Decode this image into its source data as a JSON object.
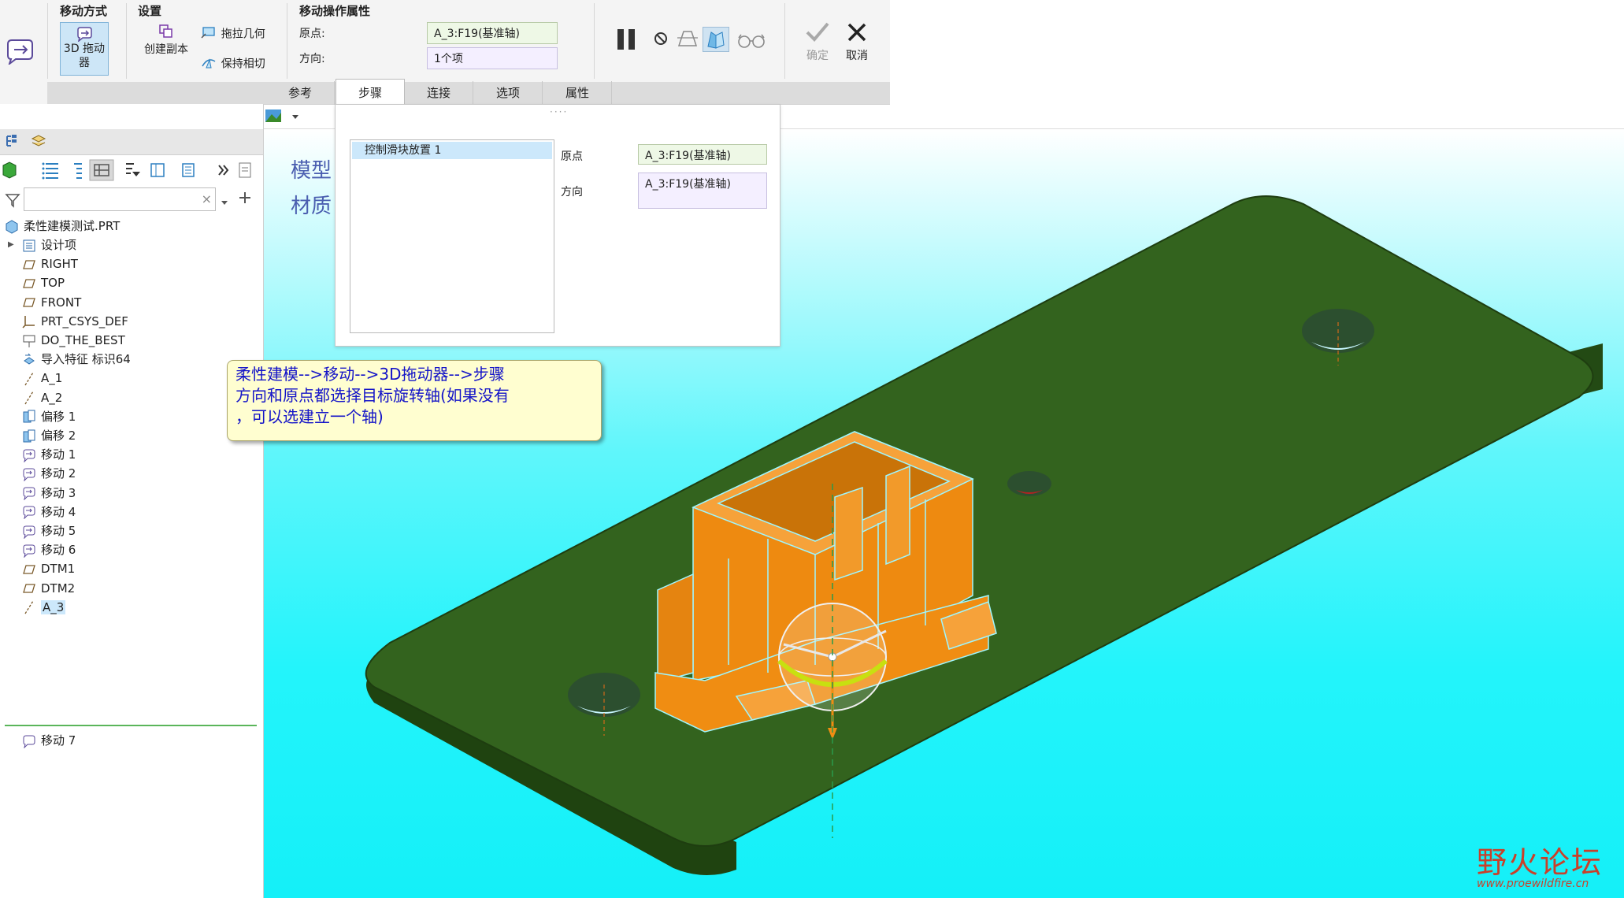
{
  "ribbon": {
    "move_type_title": "移动方式",
    "drag_3d_label_1": "3D 拖动",
    "drag_3d_label_2": "器",
    "settings_title": "设置",
    "create_copy_label": "创建副本",
    "drag_geometry_label": "拖拉几何",
    "keep_tangent_label": "保持相切",
    "move_props_title": "移动操作属性",
    "origin_label": "原点:",
    "origin_value": "A_3:F19(基准轴)",
    "direction_label": "方向:",
    "direction_value": "1个项",
    "ok_label": "确定",
    "cancel_label": "取消",
    "tabs": [
      "参考",
      "步骤",
      "连接",
      "选项",
      "属性"
    ]
  },
  "step_panel": {
    "list_item": "控制滑块放置 1",
    "origin_label": "原点",
    "origin_value": "A_3:F19(基准轴)",
    "direction_label": "方向",
    "direction_value": "A_3:F19(基准轴)"
  },
  "model_tree": {
    "search_placeholder": "",
    "root": "柔性建模测试.PRT",
    "items": [
      {
        "label": "设计项",
        "icon": "layers-icon"
      },
      {
        "label": "RIGHT",
        "icon": "datum-plane-icon"
      },
      {
        "label": "TOP",
        "icon": "datum-plane-icon"
      },
      {
        "label": "FRONT",
        "icon": "datum-plane-icon"
      },
      {
        "label": "PRT_CSYS_DEF",
        "icon": "csys-icon"
      },
      {
        "label": "DO_THE_BEST",
        "icon": "annotation-icon"
      },
      {
        "label": "导入特征 标识64",
        "icon": "import-feature-icon"
      },
      {
        "label": "A_1",
        "icon": "datum-axis-icon"
      },
      {
        "label": "A_2",
        "icon": "datum-axis-icon"
      },
      {
        "label": "偏移 1",
        "icon": "offset-icon"
      },
      {
        "label": "偏移 2",
        "icon": "offset-icon"
      },
      {
        "label": "移动 1",
        "icon": "move-icon"
      },
      {
        "label": "移动 2",
        "icon": "move-icon"
      },
      {
        "label": "移动 3",
        "icon": "move-icon"
      },
      {
        "label": "移动 4",
        "icon": "move-icon"
      },
      {
        "label": "移动 5",
        "icon": "move-icon"
      },
      {
        "label": "移动 6",
        "icon": "move-icon"
      },
      {
        "label": "DTM1",
        "icon": "datum-plane-icon"
      },
      {
        "label": "DTM2",
        "icon": "datum-plane-icon"
      },
      {
        "label": "A_3",
        "icon": "datum-axis-icon"
      }
    ],
    "insert_item": "移动 7"
  },
  "viewport": {
    "model_info_1": "模型",
    "model_info_2": "材质",
    "callout_line1": "柔性建模-->移动-->3D拖动器-->步骤",
    "callout_line2": "方向和原点都选择目标旋转轴(如果没有",
    "callout_line3": "，可以选建立一个轴)",
    "watermark_title": "野火论坛",
    "watermark_url": "www.proewildfire.cn"
  },
  "colors": {
    "plate": "#2f5e1c",
    "part": "#f08d12",
    "background_cyan": "#23f4fb",
    "callout_text": "#1414c8"
  }
}
